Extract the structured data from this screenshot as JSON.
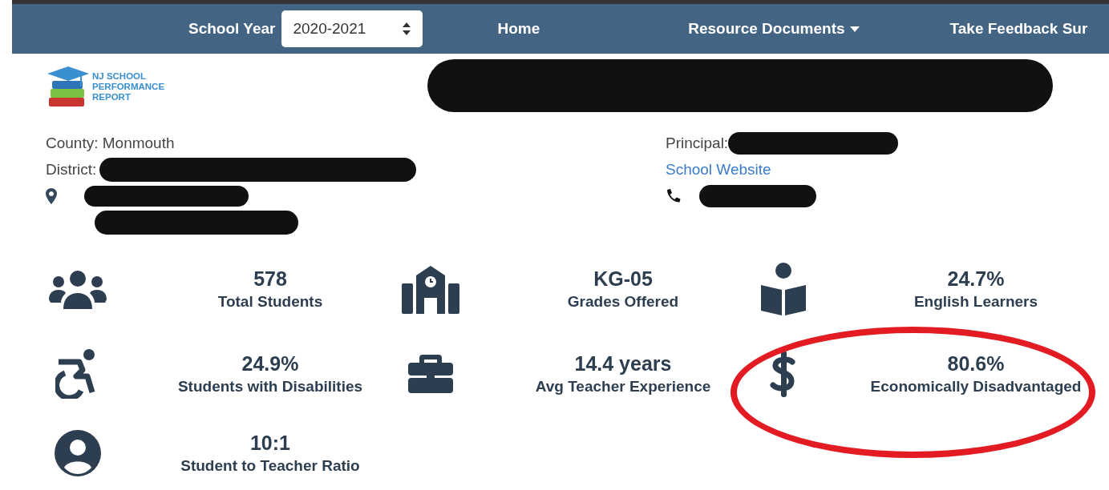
{
  "nav": {
    "school_year_label": "School Year",
    "school_year": "2020-2021",
    "links": [
      {
        "label": "Home",
        "dropdown": false
      },
      {
        "label": "Resource Documents",
        "dropdown": true
      },
      {
        "label": "Take Feedback Sur",
        "dropdown": false
      }
    ]
  },
  "logo": {
    "lines": [
      "NJ SCHOOL",
      "PERFORMANCE",
      "REPORT"
    ]
  },
  "info": {
    "county": "County: Monmouth",
    "district_label": "District:",
    "principal_label": "Principal:",
    "website": "School Website"
  },
  "stats": [
    {
      "kind": "users",
      "value": "578",
      "label": "Total Students",
      "highlighted": false
    },
    {
      "kind": "school",
      "value": "KG-05",
      "label": "Grades Offered",
      "highlighted": false
    },
    {
      "kind": "reader",
      "value": "24.7%",
      "label": "English Learners",
      "highlighted": false
    },
    {
      "kind": "wheelchair",
      "value": "24.9%",
      "label": "Students with Disabilities",
      "highlighted": false
    },
    {
      "kind": "briefcase",
      "value": "14.4 years",
      "label": "Avg Teacher Experience",
      "highlighted": false
    },
    {
      "kind": "dollar",
      "value": "80.6%",
      "label": "Economically Disadvantaged",
      "highlighted": true
    },
    {
      "kind": "user-circle",
      "value": "10:1",
      "label": "Student to Teacher Ratio",
      "highlighted": false
    }
  ]
}
